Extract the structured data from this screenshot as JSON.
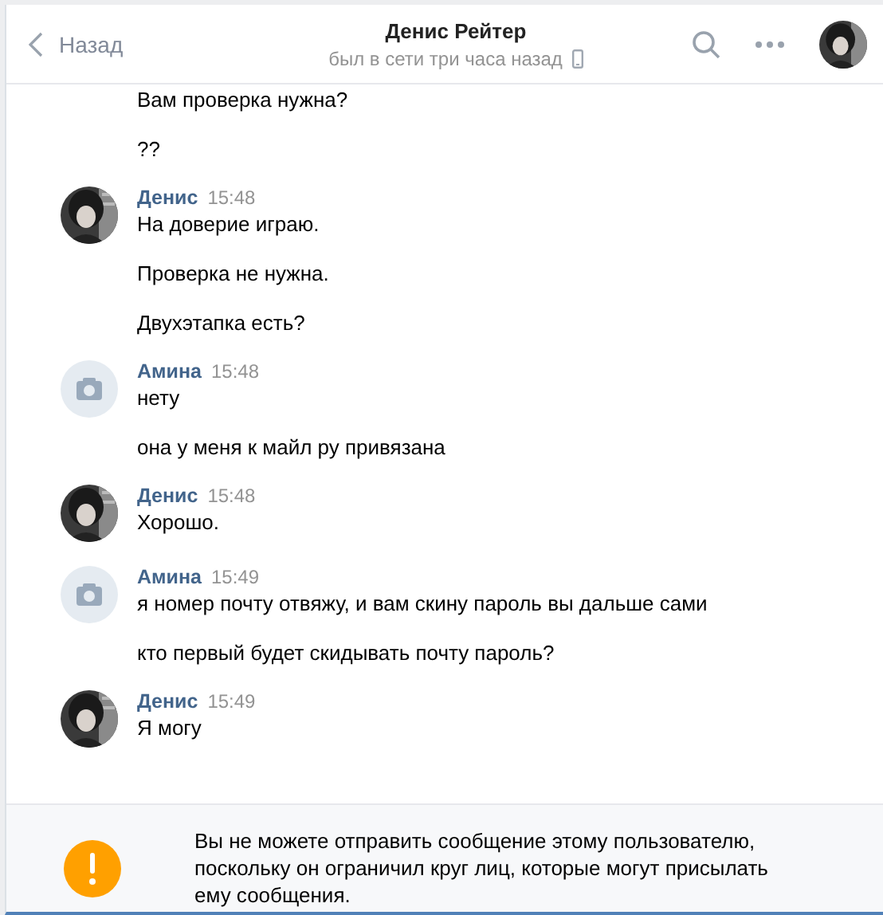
{
  "header": {
    "back": "Назад",
    "title": "Денис Рейтер",
    "status": "был в сети три часа назад",
    "mobile": true
  },
  "groups": [
    {
      "continuation": true,
      "messages": [
        "Вам проверка нужна?",
        "??"
      ]
    },
    {
      "continuation": false,
      "sender": "Денис",
      "time": "15:48",
      "avatar": {
        "kind": "picture"
      },
      "messages": [
        "На доверие играю.",
        "Проверка не нужна.",
        "Двухэтапка есть?"
      ]
    },
    {
      "continuation": false,
      "sender": "Амина",
      "time": "15:48",
      "avatar": {
        "kind": "placeholder"
      },
      "messages": [
        "нету",
        "она у меня к майл ру привязана"
      ]
    },
    {
      "continuation": false,
      "sender": "Денис",
      "time": "15:48",
      "avatar": {
        "kind": "picture"
      },
      "messages": [
        "Хорошо."
      ]
    },
    {
      "continuation": false,
      "sender": "Амина",
      "time": "15:49",
      "avatar": {
        "kind": "placeholder"
      },
      "messages": [
        "я номер почту отвяжу, и вам скину пароль вы дальше сами",
        "кто первый будет скидывать почту пароль?"
      ]
    },
    {
      "continuation": false,
      "sender": "Денис",
      "time": "15:49",
      "avatar": {
        "kind": "picture"
      },
      "messages": [
        "Я могу"
      ]
    }
  ],
  "notice": {
    "text": "Вы не можете отправить сообщение этому пользователю, поскольку он ограничил круг лиц, которые могут присылать ему сообщения."
  }
}
